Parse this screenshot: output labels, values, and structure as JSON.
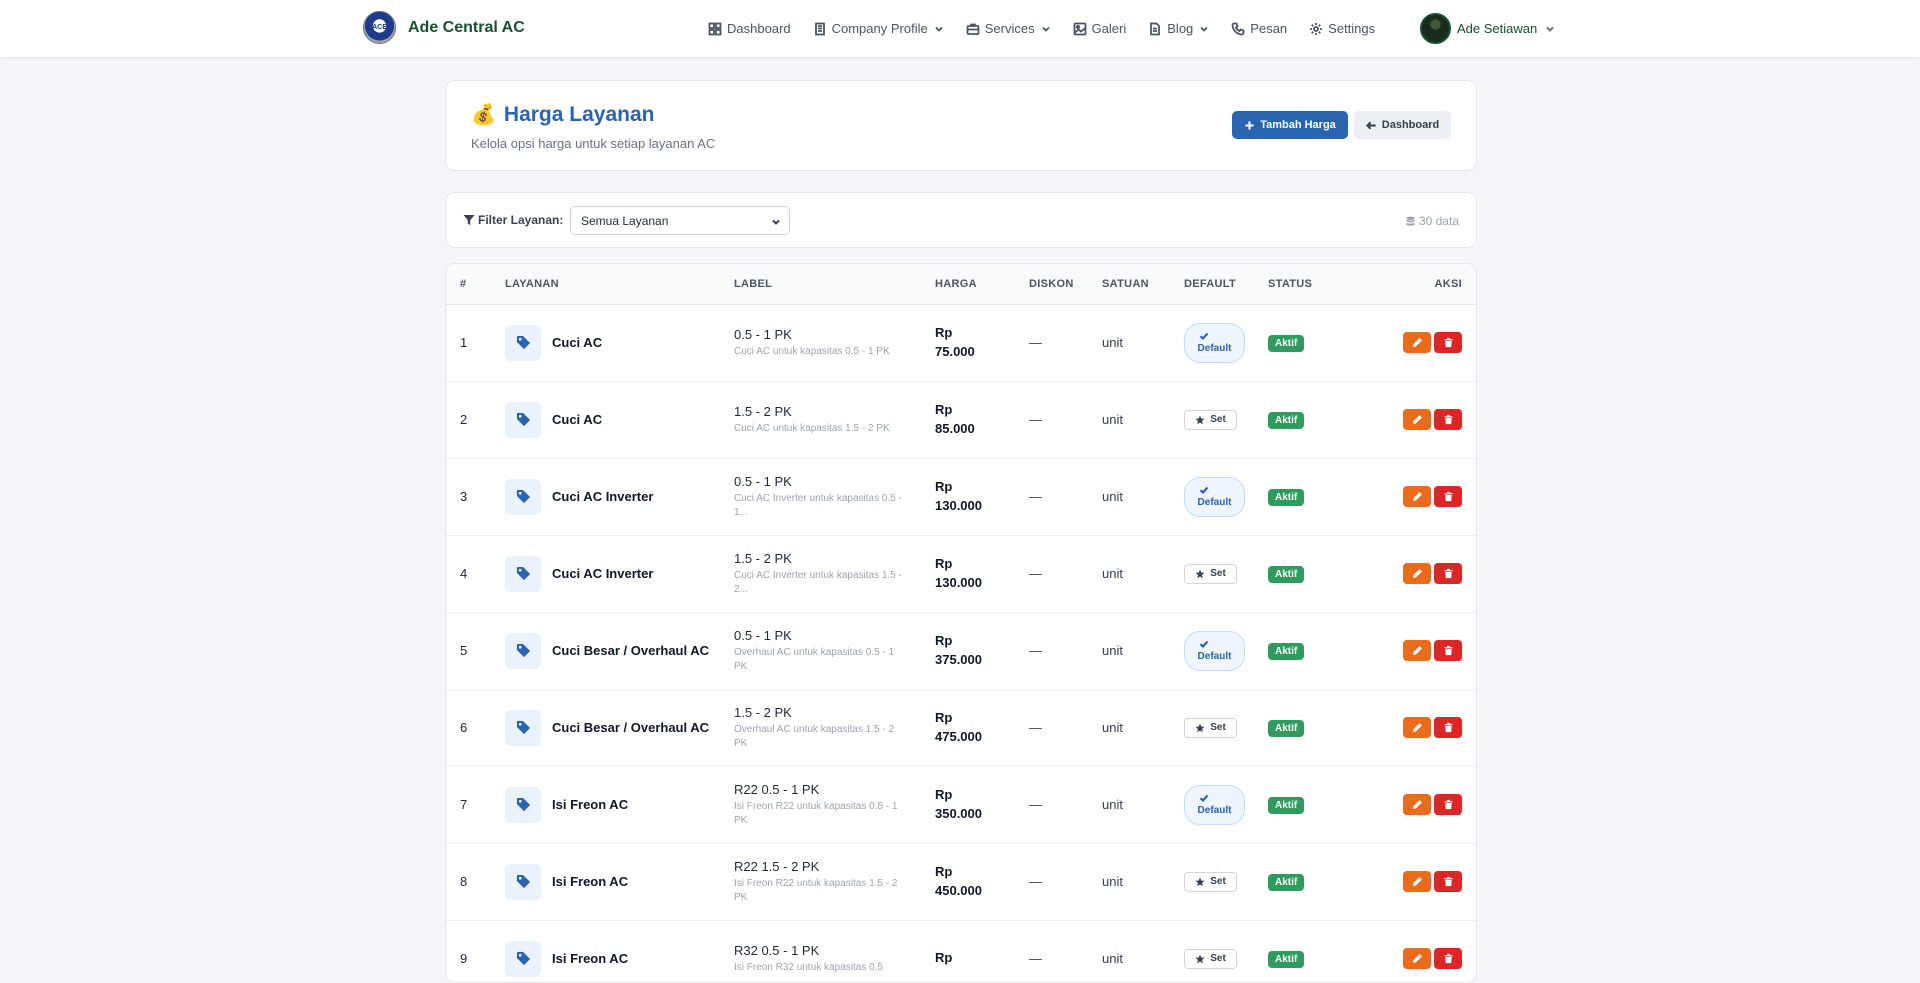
{
  "navbar": {
    "brand_name": "Ade Central AC",
    "logo_text": "ACE",
    "menu": [
      {
        "label": "Dashboard",
        "icon": "grid-icon",
        "dropdown": false
      },
      {
        "label": "Company Profile",
        "icon": "building-icon",
        "dropdown": true
      },
      {
        "label": "Services",
        "icon": "briefcase-icon",
        "dropdown": true
      },
      {
        "label": "Galeri",
        "icon": "image-icon",
        "dropdown": false
      },
      {
        "label": "Blog",
        "icon": "document-icon",
        "dropdown": true
      },
      {
        "label": "Pesan",
        "icon": "phone-icon",
        "dropdown": false
      },
      {
        "label": "Settings",
        "icon": "gear-icon",
        "dropdown": false
      }
    ],
    "user_name": "Ade Setiawan"
  },
  "header": {
    "emoji": "💰",
    "title": "Harga Layanan",
    "subtitle": "Kelola opsi harga untuk setiap layanan AC",
    "add_button": "Tambah Harga",
    "back_button": "Dashboard"
  },
  "filter": {
    "label": "Filter Layanan:",
    "selected": "Semua Layanan",
    "count": "30 data"
  },
  "table": {
    "columns": [
      "#",
      "LAYANAN",
      "LABEL",
      "HARGA",
      "DISKON",
      "SATUAN",
      "DEFAULT",
      "STATUS",
      "AKSI"
    ],
    "default_label": "Default",
    "set_label": "Set",
    "rows": [
      {
        "no": "1",
        "layanan": "Cuci AC",
        "label": "0.5 - 1 PK",
        "desc": "Cuci AC untuk kapasitas 0.5 - 1 PK",
        "harga": "Rp 75.000",
        "diskon": "—",
        "satuan": "unit",
        "default": true,
        "status": "Aktif"
      },
      {
        "no": "2",
        "layanan": "Cuci AC",
        "label": "1.5 - 2 PK",
        "desc": "Cuci AC untuk kapasitas 1.5 - 2 PK",
        "harga": "Rp 85.000",
        "diskon": "—",
        "satuan": "unit",
        "default": false,
        "status": "Aktif"
      },
      {
        "no": "3",
        "layanan": "Cuci AC Inverter",
        "label": "0.5 - 1 PK",
        "desc": "Cuci AC Inverter untuk kapasitas 0.5 - 1...",
        "harga": "Rp 130.000",
        "diskon": "—",
        "satuan": "unit",
        "default": true,
        "status": "Aktif"
      },
      {
        "no": "4",
        "layanan": "Cuci AC Inverter",
        "label": "1.5 - 2 PK",
        "desc": "Cuci AC Inverter untuk kapasitas 1.5 - 2...",
        "harga": "Rp 130.000",
        "diskon": "—",
        "satuan": "unit",
        "default": false,
        "status": "Aktif"
      },
      {
        "no": "5",
        "layanan": "Cuci Besar / Overhaul AC",
        "label": "0.5 - 1 PK",
        "desc": "Overhaul AC untuk kapasitas 0.5 - 1 PK",
        "harga": "Rp 375.000",
        "diskon": "—",
        "satuan": "unit",
        "default": true,
        "status": "Aktif"
      },
      {
        "no": "6",
        "layanan": "Cuci Besar / Overhaul AC",
        "label": "1.5 - 2 PK",
        "desc": "Overhaul AC untuk kapasitas 1.5 - 2 PK",
        "harga": "Rp 475.000",
        "diskon": "—",
        "satuan": "unit",
        "default": false,
        "status": "Aktif"
      },
      {
        "no": "7",
        "layanan": "Isi Freon AC",
        "label": "R22 0.5 - 1 PK",
        "desc": "Isi Freon R22 untuk kapasitas 0.5 - 1 PK",
        "harga": "Rp 350.000",
        "diskon": "—",
        "satuan": "unit",
        "default": true,
        "status": "Aktif"
      },
      {
        "no": "8",
        "layanan": "Isi Freon AC",
        "label": "R22 1.5 - 2 PK",
        "desc": "Isi Freon R22 untuk kapasitas 1.5 - 2 PK",
        "harga": "Rp 450.000",
        "diskon": "—",
        "satuan": "unit",
        "default": false,
        "status": "Aktif"
      },
      {
        "no": "9",
        "layanan": "Isi Freon AC",
        "label": "R32 0.5 - 1 PK",
        "desc": "Isi Freon R32 untuk kapasitas 0.5",
        "harga": "Rp",
        "diskon": "—",
        "satuan": "unit",
        "default": false,
        "status": "Aktif"
      }
    ]
  },
  "colors": {
    "primary": "#2a63b0",
    "success": "#2f9b5c",
    "edit": "#ea6b1a",
    "danger": "#dc2626",
    "brand_green": "#14532d"
  }
}
